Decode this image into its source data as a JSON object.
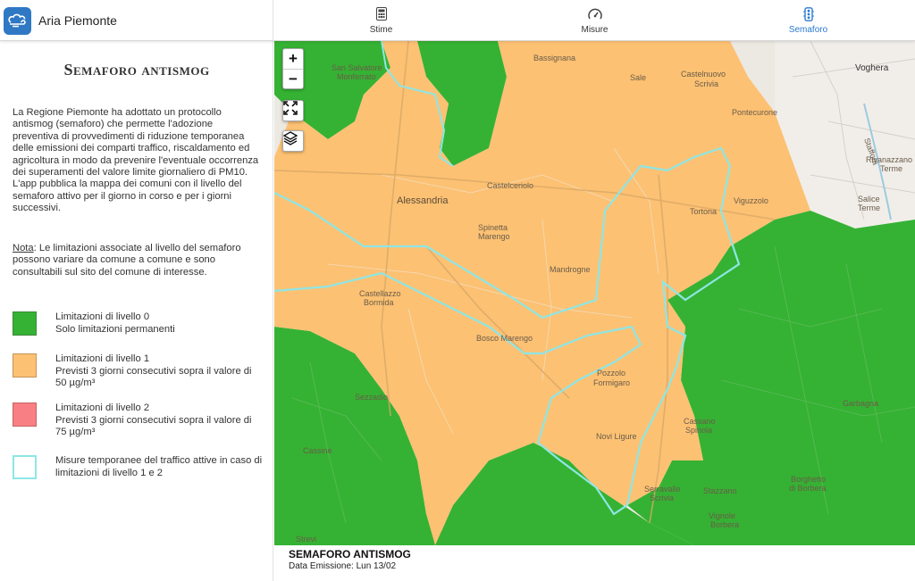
{
  "app": {
    "title": "Aria Piemonte",
    "logo": "cloud-wind-icon"
  },
  "tabs": [
    {
      "label": "Stime",
      "icon": "calculator-icon",
      "active": false
    },
    {
      "label": "Misure",
      "icon": "gauge-icon",
      "active": false
    },
    {
      "label": "Semaforo",
      "icon": "traffic-light-icon",
      "active": true
    }
  ],
  "panel": {
    "title": "Semaforo antismog",
    "description": "La Regione Piemonte ha adottato un protocollo antismog (semaforo) che permette l'adozione preventiva di provvedimenti di riduzione temporanea delle emissioni dei comparti traffico, riscaldamento ed agricoltura in modo da prevenire l'eventuale occorrenza dei superamenti del valore limite giornaliero di PM10.",
    "description2": "L'app pubblica la mappa dei comuni con il livello del semaforo attivo per il giorno in corso e per i giorni successivi.",
    "note_label": "Nota",
    "note_text": ": Le limitazioni associate al livello del semaforo possono variare da comune a comune e sono consultabili sul sito del comune di interesse."
  },
  "legend": [
    {
      "line1": "Limitazioni di livello 0",
      "line2": "Solo limitazioni permanenti",
      "color": "#35b233"
    },
    {
      "line1": "Limitazioni di livello 1",
      "line2": "Previsti 3 giorni consecutivi sopra il valore di 50 µg/m³",
      "color": "#fcc173"
    },
    {
      "line1": "Limitazioni di livello 2",
      "line2": "Previsti 3 giorni consecutivi sopra il valore di 75 µg/m³",
      "color": "#f87f83"
    },
    {
      "line1": "Misure temporanee del traffico attive in caso di limitazioni di livello 1 e 2",
      "line2": "",
      "color": "#ffffff",
      "border": "#8ee6e6"
    }
  ],
  "map": {
    "zoom_in": "+",
    "zoom_out": "−",
    "fullscreen_icon": "fullscreen-icon",
    "layers_icon": "layers-icon",
    "places": {
      "voghera": "Voghera",
      "bassignana": "Bassignana",
      "sale": "Sale",
      "castelnuovo1": "Castelnuovo",
      "castelnuovo2": "Scrivia",
      "pontecurone": "Pontecurone",
      "rivanazzano1": "Rivanazzano",
      "rivanazzano2": "Terme",
      "salice1": "Salice",
      "salice2": "Terme",
      "san_salvatore1": "San Salvatore",
      "san_salvatore2": "Monferrato",
      "castelceriolo": "Castelceriolo",
      "alessandria": "Alessandria",
      "spinetta1": "Spinetta",
      "spinetta2": "Marengo",
      "tortona": "Tortona",
      "viguzzolo": "Viguzzolo",
      "mandrogne": "Mandrogne",
      "castellazzo1": "Castellazzo",
      "castellazzo2": "Bormida",
      "bosco": "Bosco Marengo",
      "pozzolo1": "Pozzolo",
      "pozzolo2": "Formigaro",
      "sezzadio": "Sezzadio",
      "novi": "Novi Ligure",
      "cassano1": "Cassano",
      "cassano2": "Spinola",
      "garbagna": "Garbagna",
      "serravalle1": "Serravalle",
      "serravalle2": "Scrivia",
      "stazzano": "Stazzano",
      "vignole1": "Vignole",
      "vignole2": "Borbera",
      "borghetto1": "Borghetto",
      "borghetto2": "di Borbera",
      "cassine": "Cassine",
      "strevi": "Strevi",
      "staffora": "Staffora"
    }
  },
  "footer": {
    "title": "SEMAFORO ANTISMOG",
    "subtitle": "Data Emissione: Lun 13/02"
  }
}
